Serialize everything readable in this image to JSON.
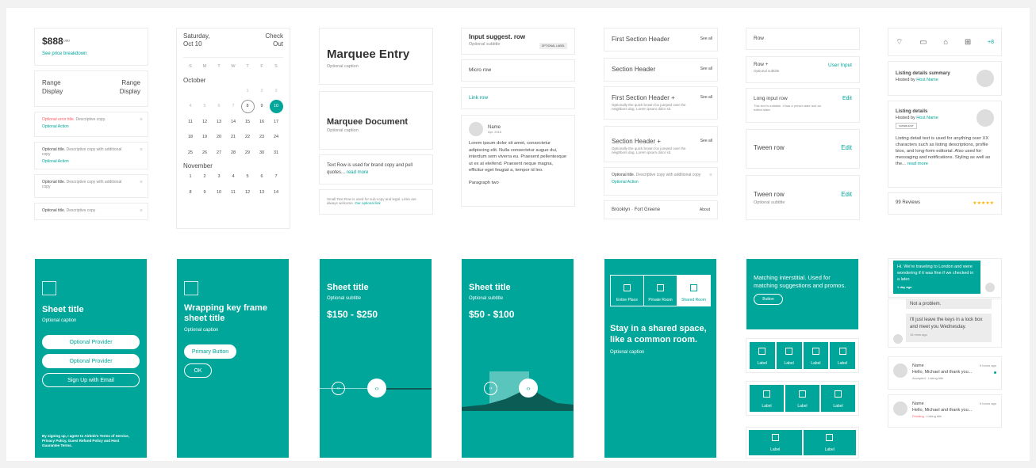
{
  "price": {
    "amount": "$888",
    "currency": "USD",
    "link": "See price breakdown"
  },
  "range": {
    "left": "Range Display",
    "right": "Range Display"
  },
  "errors": [
    {
      "title": "Optional error title.",
      "desc": " Descriptive copy.",
      "action": "Optional Action"
    },
    {
      "title": "Optional title.",
      "desc": " Descriptive copy with additional copy",
      "action": "Optional Action"
    },
    {
      "title": "Optional title.",
      "desc": " Descriptive copy with additional copy",
      "action": ""
    },
    {
      "title": "Optional title.",
      "desc": " Descriptive copy",
      "action": ""
    }
  ],
  "calendar": {
    "left": "Saturday, Oct 10",
    "right": "Check Out",
    "weekdays": [
      "S",
      "M",
      "T",
      "W",
      "T",
      "F",
      "S"
    ],
    "month1": "October",
    "oct": [
      "",
      "",
      "",
      "",
      "8",
      "9",
      "10",
      "",
      "",
      "",
      "",
      "",
      "",
      "",
      "11",
      "12",
      "13",
      "14",
      "15",
      "16",
      "17",
      "18",
      "19",
      "20",
      "21",
      "22",
      "23",
      "24",
      "25",
      "26",
      "27",
      "28",
      "29",
      "30",
      "31"
    ],
    "month2": "November",
    "nov": [
      "1",
      "2",
      "3",
      "4",
      "5",
      "6",
      "7",
      "8",
      "9",
      "10",
      "11",
      "12",
      "13",
      "14"
    ]
  },
  "octFull": [
    "",
    "",
    "",
    "",
    "1",
    "2",
    "3",
    "4",
    "5",
    "6",
    "7",
    "8",
    "9",
    "10",
    "11",
    "12",
    "13",
    "14",
    "15",
    "16",
    "17",
    "18",
    "19",
    "20",
    "21",
    "22",
    "23",
    "24",
    "25",
    "26",
    "27",
    "28",
    "29",
    "30",
    "31"
  ],
  "marquee": {
    "entry": "Marquee Entry",
    "entry_cap": "Optional caption",
    "doc": "Marquee Document",
    "doc_cap": "Optional caption",
    "text_row": "Text Row is used for brand copy and pull quotes...",
    "read_more": "read more",
    "small_text": "Small Text Row is used for sub-copy and legal. Links are always welcome.",
    "small_link": "Our optional link"
  },
  "col4": {
    "input_title": "Input suggest. row",
    "input_sub": "Optional subtitle",
    "input_tag": "OPTIONAL LABEL",
    "micro": "Micro row",
    "link": "Link row",
    "name": "Name",
    "date": "Apr. 2016",
    "para": "Lorem ipsum dolor sit amet, consectetur adipiscing elit. Nulla consectetur augue dui, interdum sem viverra eu. Praesent pellentesque ut ex at eleifend. Praesent neque magna, efficitur eget feugiat a, tempor id leo.",
    "para2": "Paragraph two"
  },
  "col5": {
    "h1": "First Section Header",
    "h2": "Section Header",
    "h3": "First Section Header +",
    "h4": "Section Header +",
    "see": "See all",
    "desc": "Optionally the quick brown fox jumped over the neighbors dog. Lorem ipsum dolor sit.",
    "alert_title": "Optional title.",
    "alert_desc": " Descriptive copy with additional copy",
    "alert_action": "Optional Action",
    "loc": "Brooklyn",
    "loc2": "Fort Greene",
    "about": "About"
  },
  "col6": {
    "row": "Row",
    "row_plus": "Row +",
    "user_input": "User Input",
    "opt_sub": "Optional subtitle",
    "long": "Long input row",
    "long_desc": "This text is editable. It has a preset state and an edited state.",
    "edit": "Edit",
    "tween": "Tween row",
    "tween2": "Tween row"
  },
  "col7": {
    "plus": "+8",
    "summary": "Listing details summary",
    "hosted": "Hosted by",
    "host": "Host Name",
    "details": "Listing details",
    "badge": "SUPERHOST",
    "long": "Listing detail text is used for anything over XX characters such as listing descriptions, profile bios, and long-form editorial. Also used for messaging and notifications. Styling as well as the...",
    "read_more": "read more",
    "reviews": "99 Reviews",
    "stars": "★★★★★"
  },
  "sheet1": {
    "title": "Sheet title",
    "caption": "Optional caption",
    "btn1": "Optional Provider",
    "btn2": "Optional Provider",
    "btn3": "Sign Up with Email",
    "legal": "By signing up, I agree to Airbnb's Terms of Service, Privacy Policy, Guest Refund Policy and Host Guarantee Terms."
  },
  "sheet2": {
    "title": "Wrapping key frame sheet title",
    "caption": "Optional caption",
    "primary": "Primary Button",
    "ok": "OK"
  },
  "sheet3": {
    "title": "Sheet title",
    "sub": "Optional subtitle",
    "price": "$150 - $250"
  },
  "sheet4": {
    "title": "Sheet title",
    "sub": "Optional subtitle",
    "price": "$50 - $100"
  },
  "sheet5": {
    "tiles": [
      "Entire Place",
      "Private Room",
      "Shared Room"
    ],
    "title": "Stay in a shared space, like a common room.",
    "caption": "Optional caption"
  },
  "sheet6": {
    "title": "Matching interstitial. Used for matching suggestions and promos.",
    "button": "Button",
    "label": "Label"
  },
  "chat": {
    "msg1": "Hi. We're traveling to London and were wondering if it was fine if we checked in a later.",
    "time1": "1 day ago",
    "msg2": "Not a problem.",
    "msg3": "I'll just leave the keys in a lock box and meet you Wednesday.",
    "time2": "16 mins ago",
    "name": "Name",
    "ago": "5 hours ago",
    "preview": "Hello, Michael and thank you...",
    "status1": "Accepted",
    "listing": "Listing title",
    "status2": "Pending"
  },
  "icons": [
    "wifi-icon",
    "tv-icon",
    "gift-icon",
    "grid-icon"
  ],
  "colors": {
    "accent": "#00a699",
    "error": "#ff5a5f",
    "star": "#ffb400"
  }
}
